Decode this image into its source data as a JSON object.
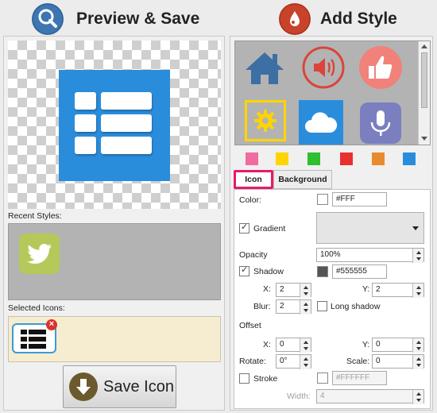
{
  "left": {
    "title": "Preview & Save",
    "recent_styles_label": "Recent Styles:",
    "selected_icons_label": "Selected Icons:",
    "save_button_label": "Save Icon",
    "remove_badge": "×"
  },
  "right": {
    "title": "Add Style",
    "swatch_colors": [
      "#f06ba0",
      "#ffd400",
      "#2fbf2f",
      "#e8302f",
      "#e88a2e",
      "#2a8ddc"
    ],
    "tabs": [
      {
        "label": "Icon"
      },
      {
        "label": "Background"
      }
    ],
    "form": {
      "color_label": "Color:",
      "color_value": "#FFF",
      "gradient_label": "Gradient",
      "opacity_label": "Opacity",
      "opacity_value": "100%",
      "shadow_label": "Shadow",
      "shadow_value": "#555555",
      "x_label": "X:",
      "x_value": "2",
      "y_label": "Y:",
      "y_value": "2",
      "blur_label": "Blur:",
      "blur_value": "2",
      "long_shadow_label": "Long shadow",
      "offset_label": "Offset",
      "offset_x_label": "X:",
      "offset_x_value": "0",
      "offset_y_label": "Y:",
      "offset_y_value": "0",
      "rotate_label": "Rotate:",
      "rotate_value": "0°",
      "scale_label": "Scale:",
      "scale_value": "0",
      "stroke_label": "Stroke",
      "stroke_value": "#FFFFFF",
      "width_label": "Width:",
      "width_value": "4"
    }
  },
  "icons": {
    "header_left": "magnifier-icon",
    "header_right": "drop-icon",
    "preview": "list-icon",
    "recent": "twitter-bird-icon",
    "selected": "list-icon",
    "save": "download-arrow-icon",
    "gallery": [
      "home-icon",
      "speaker-icon",
      "thumbs-up-icon",
      "gear-icon",
      "cloud-icon",
      "microphone-icon"
    ]
  },
  "colors": {
    "preview_bg": "#2a8ddc",
    "recent_tile": "#b5c95a",
    "tile_gray": "#b3b3b3",
    "selected_area": "#f6edd0",
    "active_tab_border": "#e6196b",
    "header_left_icon": "#3d76b0",
    "header_right_icon": "#c9422a"
  }
}
